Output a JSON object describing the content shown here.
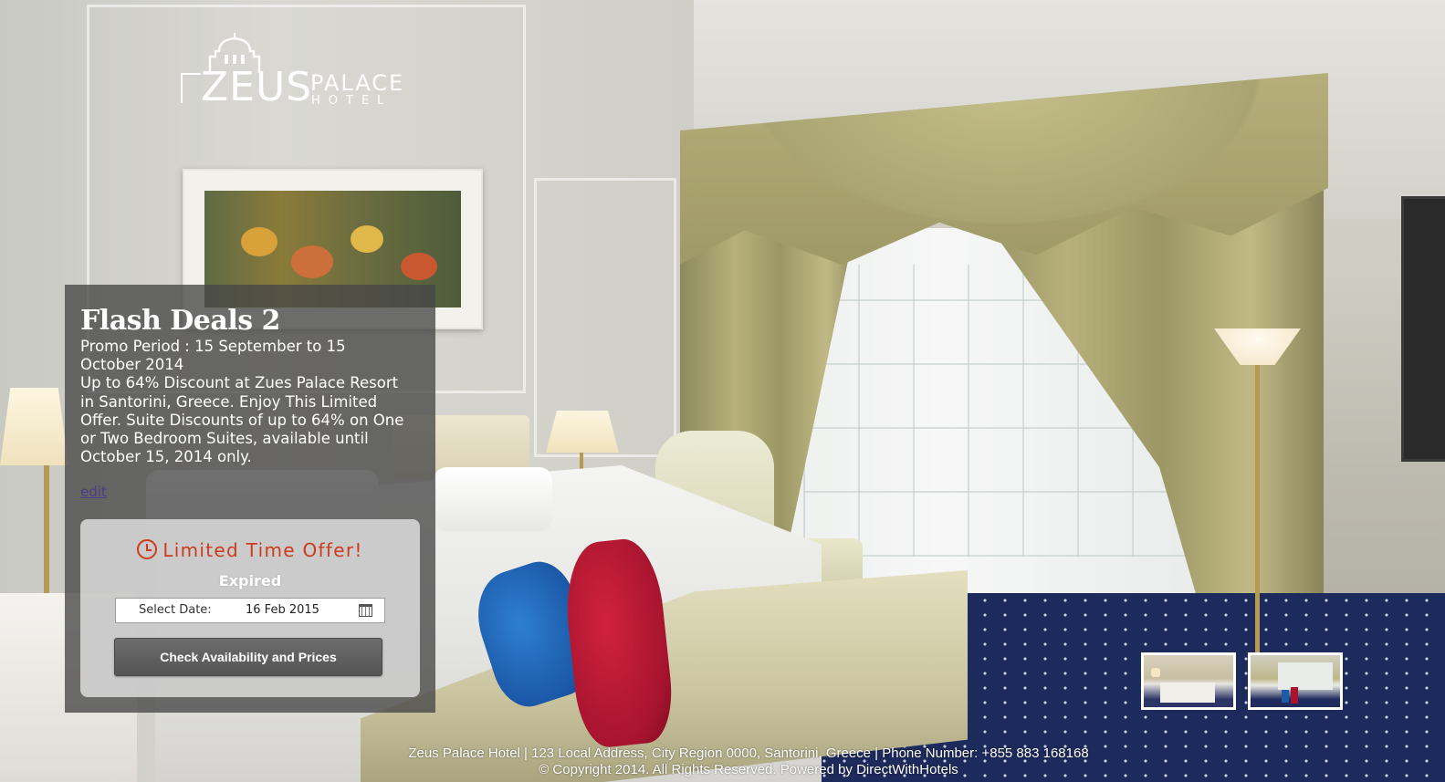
{
  "brand": {
    "name_main": "ZEUS",
    "name_sub": "PALACE",
    "name_small": "HOTEL"
  },
  "promo": {
    "title": "Flash Deals 2",
    "description": "Promo Period : 15 September to 15 October 2014\nUp to 64% Discount at Zues Palace Resort in Santorini, Greece. Enjoy This Limited Offer. Suite Discounts of up to 64% on One or Two Bedroom Suites, available until October 15, 2014 only.",
    "edit_link": "edit"
  },
  "offer": {
    "title": "Limited Time Offer!",
    "status": "Expired",
    "date_label": "Select Date:",
    "date_value": "16 Feb 2015",
    "button_label": "Check Availability and Prices"
  },
  "thumbnails": [
    {
      "name": "room-thumbnail-1"
    },
    {
      "name": "room-thumbnail-2"
    }
  ],
  "footer": {
    "line1": "Zeus Palace Hotel | 123 Local Address, City Region 0000, Santorini, Greece | Phone Number: +855 883 168168",
    "line2": "© Copyright 2014. All Rights Reserved. Powered by DirectWithHotels"
  },
  "icons": {
    "clock": "clock-icon",
    "calendar": "calendar-icon"
  },
  "colors": {
    "offer_accent": "#cf3a1c",
    "panel_bg": "rgba(70,70,70,0.78)",
    "button_bg": "#5f5f5f",
    "link": "#4b3c8a"
  }
}
